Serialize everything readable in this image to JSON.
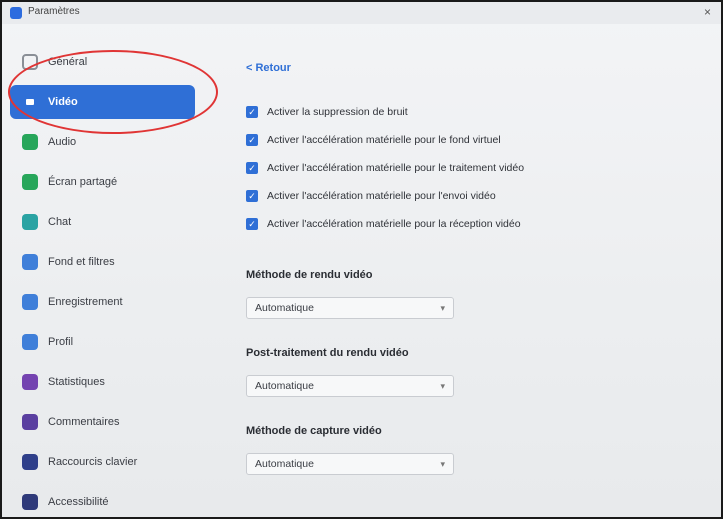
{
  "window": {
    "title": "Paramètres",
    "close": "×"
  },
  "sidebar": {
    "items": [
      {
        "label": "Général"
      },
      {
        "label": "Vidéo"
      },
      {
        "label": "Audio"
      },
      {
        "label": "Écran partagé"
      },
      {
        "label": "Chat"
      },
      {
        "label": "Fond et filtres"
      },
      {
        "label": "Enregistrement"
      },
      {
        "label": "Profil"
      },
      {
        "label": "Statistiques"
      },
      {
        "label": "Commentaires"
      },
      {
        "label": "Raccourcis clavier"
      },
      {
        "label": "Accessibilité"
      }
    ],
    "active_index": 1
  },
  "main": {
    "back_label": "< Retour",
    "checkboxes": [
      {
        "label": "Activer la suppression de bruit",
        "checked": true
      },
      {
        "label": "Activer l'accélération matérielle pour le fond virtuel",
        "checked": true
      },
      {
        "label": "Activer l'accélération matérielle pour le traitement vidéo",
        "checked": true
      },
      {
        "label": "Activer l'accélération matérielle pour l'envoi vidéo",
        "checked": true
      },
      {
        "label": "Activer l'accélération matérielle pour la réception vidéo",
        "checked": true
      }
    ],
    "render_method": {
      "title": "Méthode de rendu vidéo",
      "value": "Automatique"
    },
    "post_processing": {
      "title": "Post-traitement du rendu vidéo",
      "value": "Automatique"
    },
    "capture_method": {
      "title": "Méthode de capture vidéo",
      "value": "Automatique"
    }
  },
  "colors": {
    "accent": "#2f6fd6",
    "annotation": "#e03535"
  },
  "icons": {
    "checkbox_mark": "✓",
    "select_chevron": "▾"
  }
}
